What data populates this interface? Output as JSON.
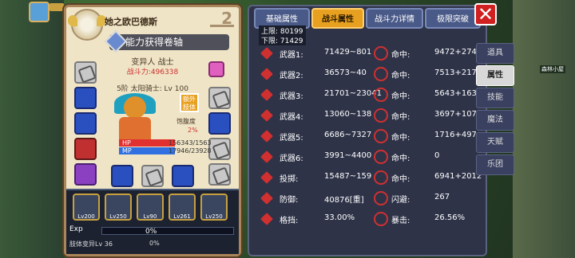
{
  "character": {
    "name": "她之欧巴德斯",
    "rank": "2",
    "title": "能力获得卷轴",
    "class": "变异人 战士",
    "power": "战斗力:496338",
    "level": "5阶 太阳骑士: Lv 100",
    "extra_badge": "额外肢体",
    "fatigue_label": "饱腹度",
    "fatigue_value": "2%",
    "hp_label": "HP",
    "hp_value": "156343/1563",
    "mp_label": "MP",
    "mp_value": "17946/23928"
  },
  "skills": [
    {
      "level": "Lv200"
    },
    {
      "level": "Lv250"
    },
    {
      "level": "Lv90"
    },
    {
      "level": "Lv261"
    },
    {
      "level": "Lv250"
    }
  ],
  "exp": {
    "label": "Exp",
    "percent": "0%",
    "label2": "肢体变异Lv 36",
    "percent2": "0%"
  },
  "tabs": [
    "基础属性",
    "战斗属性",
    "战斗力详情",
    "极限突破"
  ],
  "limits": {
    "upper": "上限: 80199",
    "lower": "下限: 71429"
  },
  "stats": [
    {
      "name": "武器1:",
      "value": "71429~801",
      "name2": "命中:",
      "value2": "9472+2746"
    },
    {
      "name": "武器2:",
      "value": "36573~40",
      "name2": "命中:",
      "value2": "7513+2178"
    },
    {
      "name": "武器3:",
      "value": "21701~23041",
      "name2": "命中:",
      "value2": "5643+1636"
    },
    {
      "name": "武器4:",
      "value": "13060~138",
      "name2": "命中:",
      "value2": "3697+1072"
    },
    {
      "name": "武器5:",
      "value": "6686~7327",
      "name2": "命中:",
      "value2": "1716+497"
    },
    {
      "name": "武器6:",
      "value": "3991~4400",
      "name2": "命中:",
      "value2": "0"
    },
    {
      "name": "投掷:",
      "value": "15487~159",
      "name2": "命中:",
      "value2": "6941+2012"
    },
    {
      "name": "防御:",
      "value": "40876[重]",
      "name2": "闪避:",
      "value2": "267"
    },
    {
      "name": "格挡:",
      "value": "33.00%",
      "name2": "暴击:",
      "value2": "26.56%"
    }
  ],
  "side_menu": [
    "道具",
    "属性",
    "技能",
    "魔法",
    "天赋",
    "乐团"
  ],
  "map_label": "森林小屋",
  "close_label": "✕"
}
